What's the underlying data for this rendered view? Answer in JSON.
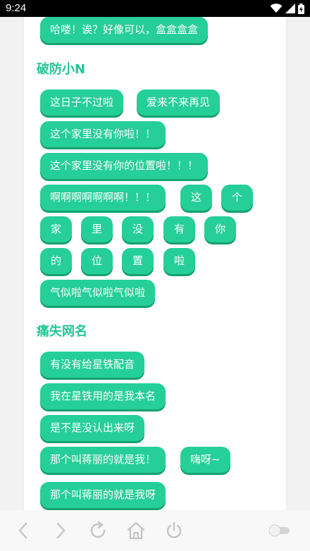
{
  "status_bar": {
    "time": "9:24",
    "icons": [
      "wifi-icon",
      "signal-icon",
      "battery-icon"
    ]
  },
  "sections": [
    {
      "title": "",
      "buttons": [
        "哈喽！诶？好像可以，盒盒盒盒"
      ]
    },
    {
      "title": "破防小N",
      "buttons": [
        "这日子不过啦",
        "爱来不来再见",
        "这个家里没有你啦！！",
        "这个家里没有你的位置啦！！！",
        "啊啊啊啊啊啊啊！！！",
        "这",
        "个",
        "家",
        "里",
        "没",
        "有",
        "你",
        "的",
        "位",
        "置",
        "啦",
        "气似啦气似啦气似啦"
      ]
    },
    {
      "title": "痛失网名",
      "buttons": [
        "有没有给星铁配音",
        "我在星铁用的是我本名",
        "是不是没认出来呀",
        "那个叫蒋丽的就是我！",
        "嗨呀~",
        "那个叫蒋丽的就是我呀"
      ]
    }
  ],
  "nav": {
    "buttons": [
      "back-icon",
      "forward-icon",
      "reload-icon",
      "home-icon",
      "power-icon",
      "toggle-switch"
    ]
  },
  "colors": {
    "accent": "#22c796",
    "button": "#25cf97",
    "button_shadow": "#17a070"
  }
}
